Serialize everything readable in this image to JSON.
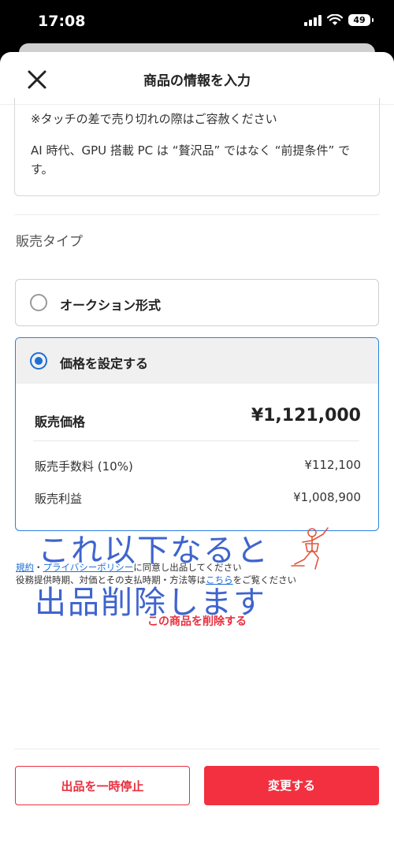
{
  "status": {
    "time": "17:08",
    "battery": "49"
  },
  "header": {
    "title": "商品の情報を入力"
  },
  "description": {
    "lines": [
      "※タッチの差で売り切れの際はご容赦ください",
      "AI 時代、GPU 搭載 PC は “贅沢品” ではなく “前提条件” で",
      "す。"
    ]
  },
  "sale_type": {
    "title": "販売タイプ",
    "options": [
      {
        "label": "オークション形式",
        "selected": false
      },
      {
        "label": "価格を設定する",
        "selected": true
      }
    ]
  },
  "pricing": {
    "price_label": "販売価格",
    "price_value": "¥1,121,000",
    "fee_label": "販売手数料 (10%)",
    "fee_value": "¥112,100",
    "profit_label": "販売利益",
    "profit_value": "¥1,008,900"
  },
  "overlay": {
    "line1": "これ以下なると",
    "line2": "出品削除します"
  },
  "terms": {
    "link1": "規約",
    "dot": "・",
    "link2": "プライバシーポリシー",
    "agree": "に同意し出品してください",
    "line2_pre": "役務提供時期、対価とその支払時期・方法等は",
    "link3": "こちら",
    "line2_post": "をご覧ください"
  },
  "delete_label": "この商品を削除する",
  "buttons": {
    "pause": "出品を一時停止",
    "change": "変更する"
  },
  "colors": {
    "accent": "#F2303F",
    "primary": "#1D6FD6",
    "overlay_text": "#2E57C9"
  }
}
